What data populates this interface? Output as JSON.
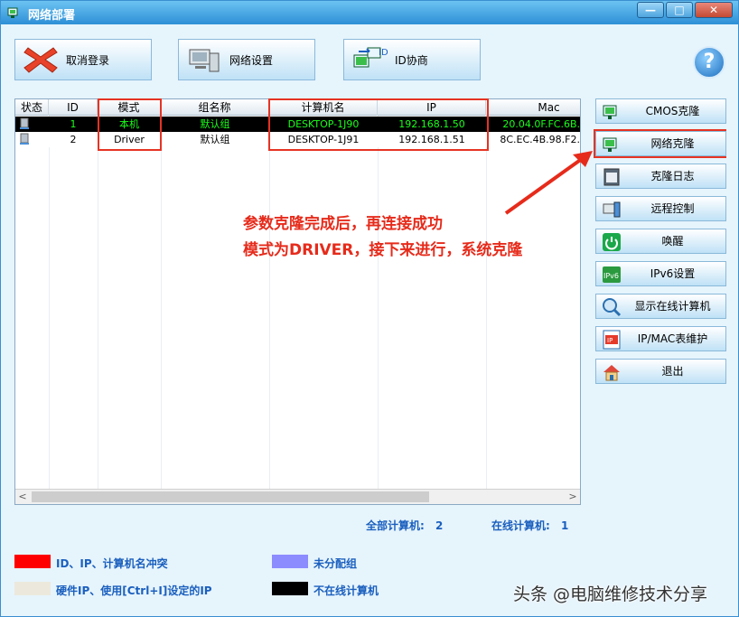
{
  "window": {
    "title": "网络部署",
    "minimize": "—",
    "maximize": "□",
    "close": "✕"
  },
  "toolbar": {
    "cancel_login": "取消登录",
    "network_settings": "网络设置",
    "id_negotiate": "ID协商",
    "id_tag": "ID",
    "help": "?"
  },
  "grid": {
    "columns": [
      "状态",
      "ID",
      "模式",
      "组名称",
      "计算机名",
      "IP",
      "Mac"
    ],
    "rows": [
      {
        "id": "1",
        "mode": "本机",
        "group": "默认组",
        "computer": "DESKTOP-1J90",
        "ip": "192.168.1.50",
        "mac": "20.04.0F.FC.6B.",
        "offline": true
      },
      {
        "id": "2",
        "mode": "Driver",
        "group": "默认组",
        "computer": "DESKTOP-1J91",
        "ip": "192.168.1.51",
        "mac": "8C.EC.4B.98.F2.",
        "offline": false
      }
    ],
    "scroll_left": "<",
    "scroll_right": ">"
  },
  "sidebar": {
    "items": [
      {
        "label": "CMOS克隆",
        "icon": "cmos-clone-icon"
      },
      {
        "label": "网络克隆",
        "icon": "network-clone-icon"
      },
      {
        "label": "克隆日志",
        "icon": "log-icon"
      },
      {
        "label": "远程控制",
        "icon": "remote-control-icon"
      },
      {
        "label": "唤醒",
        "icon": "power-icon"
      },
      {
        "label": "IPv6设置",
        "icon": "ipv6-icon",
        "icon_text": "IPv6"
      },
      {
        "label": "显示在线计算机",
        "icon": "search-computer-icon"
      },
      {
        "label": "IP/MAC表维护",
        "icon": "ip-table-icon",
        "icon_text": "IP"
      },
      {
        "label": "退出",
        "icon": "exit-house-icon"
      }
    ]
  },
  "annotation": {
    "line1": "参数克隆完成后，再连接成功",
    "line2": "模式为DRIVER，接下来进行，系统克隆",
    "color": "#e62b1b"
  },
  "stats": {
    "total_label": "全部计算机:",
    "total_value": "2",
    "online_label": "在线计算机:",
    "online_value": "1"
  },
  "legend": [
    {
      "text": "ID、IP、计算机名冲突",
      "color": "#ff0000"
    },
    {
      "text": "未分配组",
      "color": "#8c8cff"
    },
    {
      "text": "硬件IP、使用[Ctrl+I]设定的IP",
      "color": "#ece9dc"
    },
    {
      "text": "不在线计算机",
      "color": "#000000"
    }
  ],
  "watermark": "头条 @电脑维修技术分享"
}
